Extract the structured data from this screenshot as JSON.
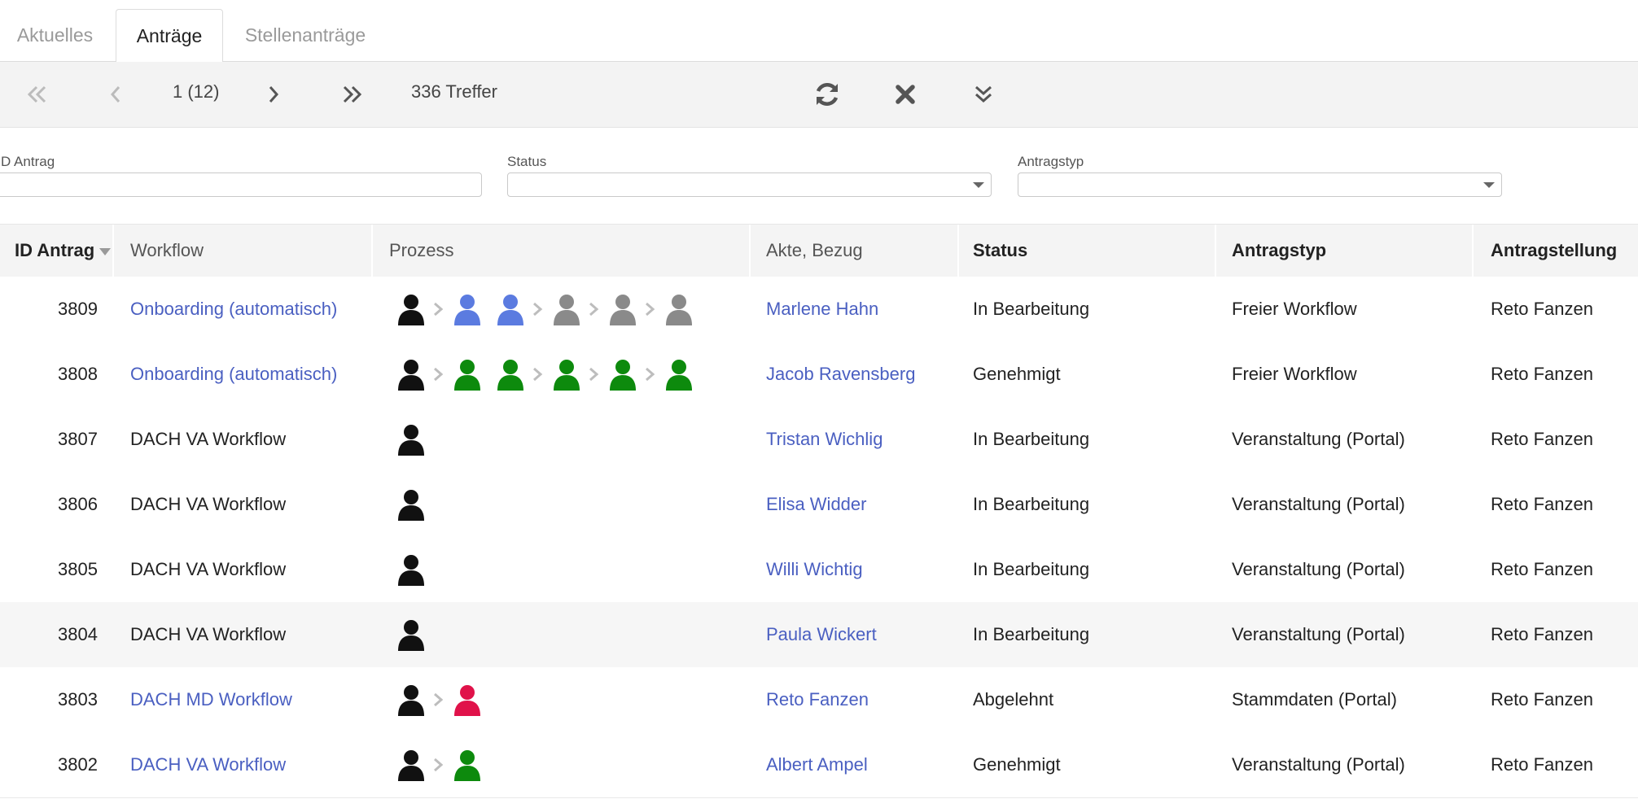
{
  "tabs": [
    {
      "label": "Aktuelles",
      "active": false
    },
    {
      "label": "Anträge",
      "active": true
    },
    {
      "label": "Stellenanträge",
      "active": false
    }
  ],
  "toolbar": {
    "page": "1 (12)",
    "hits": "336 Treffer",
    "icons": [
      "first-page-icon",
      "prev-page-icon",
      "next-page-icon",
      "last-page-icon",
      "refresh-icon",
      "clear-filter-icon",
      "expand-icon"
    ]
  },
  "filters": {
    "id_label": "D Antrag",
    "id_value": "",
    "status_label": "Status",
    "status_value": "",
    "type_label": "Antragstyp",
    "type_value": ""
  },
  "columns": {
    "id": "ID Antrag",
    "workflow": "Workflow",
    "prozess": "Prozess",
    "akte": "Akte, Bezug",
    "status": "Status",
    "typ": "Antragstyp",
    "antragstellung": "Antragstellung"
  },
  "colors": {
    "black": "#111111",
    "blue": "#5b7be0",
    "gray": "#8a8a8a",
    "green": "#0d8a0d",
    "red": "#e0124a",
    "link": "#4a5fc1"
  },
  "rows": [
    {
      "id": "3809",
      "workflow": "Onboarding (automatisch)",
      "workflow_link": true,
      "process": [
        "black",
        "blue",
        "blue",
        "gray",
        "gray",
        "gray"
      ],
      "process_sep": [
        1,
        0,
        1,
        1,
        1
      ],
      "akte": "Marlene Hahn",
      "status": "In Bearbeitung",
      "typ": "Freier Workflow",
      "antragstellung": "Reto Fanzen",
      "highlight": false
    },
    {
      "id": "3808",
      "workflow": "Onboarding (automatisch)",
      "workflow_link": true,
      "process": [
        "black",
        "green",
        "green",
        "green",
        "green",
        "green"
      ],
      "process_sep": [
        1,
        0,
        1,
        1,
        1
      ],
      "akte": "Jacob Ravensberg",
      "status": "Genehmigt",
      "typ": "Freier Workflow",
      "antragstellung": "Reto Fanzen",
      "highlight": false
    },
    {
      "id": "3807",
      "workflow": "DACH VA Workflow",
      "workflow_link": false,
      "process": [
        "black"
      ],
      "process_sep": [],
      "akte": "Tristan Wichlig",
      "status": "In Bearbeitung",
      "typ": "Veranstaltung (Portal)",
      "antragstellung": "Reto Fanzen",
      "highlight": false
    },
    {
      "id": "3806",
      "workflow": "DACH VA Workflow",
      "workflow_link": false,
      "process": [
        "black"
      ],
      "process_sep": [],
      "akte": "Elisa Widder",
      "status": "In Bearbeitung",
      "typ": "Veranstaltung (Portal)",
      "antragstellung": "Reto Fanzen",
      "highlight": false
    },
    {
      "id": "3805",
      "workflow": "DACH VA Workflow",
      "workflow_link": false,
      "process": [
        "black"
      ],
      "process_sep": [],
      "akte": "Willi Wichtig",
      "status": "In Bearbeitung",
      "typ": "Veranstaltung (Portal)",
      "antragstellung": "Reto Fanzen",
      "highlight": false
    },
    {
      "id": "3804",
      "workflow": "DACH VA Workflow",
      "workflow_link": false,
      "process": [
        "black"
      ],
      "process_sep": [],
      "akte": "Paula Wickert",
      "status": "In Bearbeitung",
      "typ": "Veranstaltung (Portal)",
      "antragstellung": "Reto Fanzen",
      "highlight": true
    },
    {
      "id": "3803",
      "workflow": "DACH MD Workflow",
      "workflow_link": true,
      "process": [
        "black",
        "red"
      ],
      "process_sep": [
        1
      ],
      "akte": "Reto Fanzen",
      "status": "Abgelehnt",
      "typ": "Stammdaten (Portal)",
      "antragstellung": "Reto Fanzen",
      "highlight": false
    },
    {
      "id": "3802",
      "workflow": "DACH VA Workflow",
      "workflow_link": true,
      "process": [
        "black",
        "green"
      ],
      "process_sep": [
        1
      ],
      "akte": "Albert Ampel",
      "status": "Genehmigt",
      "typ": "Veranstaltung (Portal)",
      "antragstellung": "Reto Fanzen",
      "highlight": false
    }
  ]
}
